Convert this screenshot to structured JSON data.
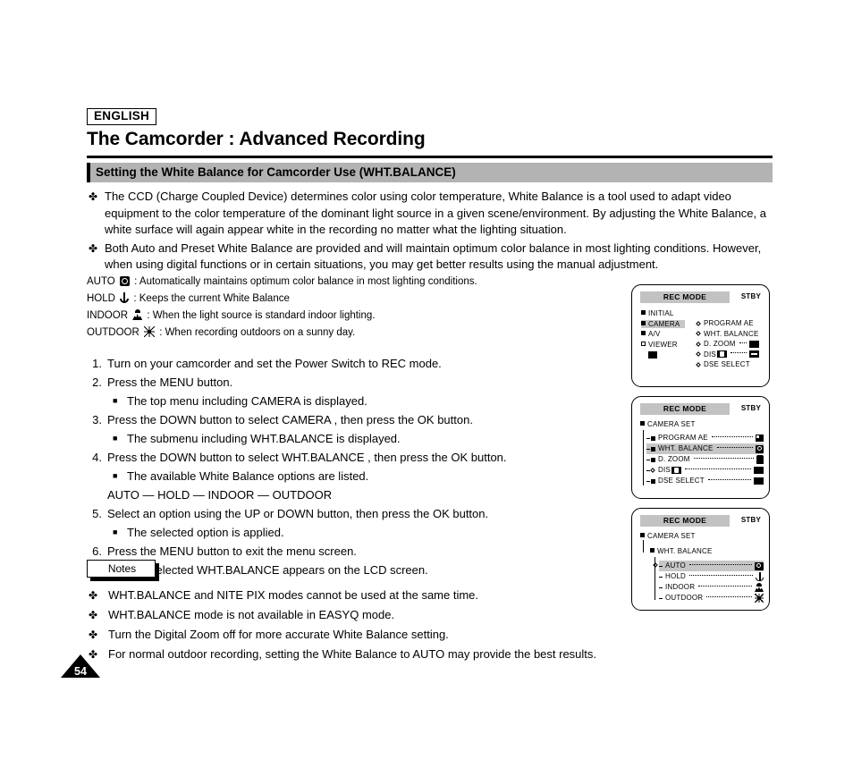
{
  "header": {
    "language_tag": "ENGLISH",
    "title": "The Camcorder : Advanced Recording",
    "section_title": "Setting the White Balance for Camcorder Use (WHT.BALANCE)"
  },
  "intro_bullets": [
    "The CCD (Charge Coupled Device) determines color using color temperature, White Balance is a tool used to adapt video equipment to the color temperature of the dominant light source in a given scene/environment. By adjusting the White Balance, a white surface will again appear white in the recording no matter what the lighting situation.",
    "Both Auto and Preset White Balance are provided and will maintain optimum color balance in most lighting conditions. However, when using digital functions or in certain situations, you may get better results using the manual adjustment."
  ],
  "definitions": [
    {
      "term": "AUTO",
      "icon": "auto-face-icon",
      "text": ": Automatically maintains optimum color balance in most lighting conditions."
    },
    {
      "term": "HOLD",
      "icon": "hold-anchor-icon",
      "text": ": Keeps the current White Balance"
    },
    {
      "term": "INDOOR",
      "icon": "indoor-lamp-icon",
      "text": ": When the light source is standard indoor lighting."
    },
    {
      "term": "OUTDOOR",
      "icon": "outdoor-sun-icon",
      "text": ": When recording outdoors on a sunny day."
    }
  ],
  "steps": [
    {
      "num": "1.",
      "text": "Turn on your camcorder and set the Power Switch to REC mode."
    },
    {
      "num": "2.",
      "text": "Press the MENU button."
    },
    {
      "sub": "The top menu including  CAMERA  is displayed."
    },
    {
      "num": "3.",
      "text": "Press the DOWN button to select  CAMERA , then press the OK button."
    },
    {
      "sub": "The submenu including  WHT.BALANCE  is displayed."
    },
    {
      "num": "4.",
      "text": "Press the DOWN button to select  WHT.BALANCE , then press the OK button."
    },
    {
      "sub": "The available White Balance options are listed."
    },
    {
      "plain": "AUTO — HOLD — INDOOR — OUTDOOR"
    },
    {
      "num": "5.",
      "text": "Select an option using the UP or DOWN button, then press the OK button."
    },
    {
      "sub": "The selected option is applied."
    },
    {
      "num": "6.",
      "text": "Press the MENU button to exit the menu screen."
    },
    {
      "sub": "The selected WHT.BALANCE appears on the LCD screen."
    }
  ],
  "notes": {
    "label": "Notes",
    "items": [
      "WHT.BALANCE and NITE PIX modes cannot be used at the same time.",
      "WHT.BALANCE mode is not available in EASYQ mode.",
      "Turn the Digital Zoom off for more accurate White Balance setting.",
      "For normal outdoor recording, setting the White Balance to AUTO may provide the best results."
    ]
  },
  "page_number": "54",
  "lcd_panels": {
    "panel1": {
      "mode_label": "REC MODE",
      "status": "STBY",
      "left_items": [
        {
          "label": "INITIAL",
          "selected": false
        },
        {
          "label": "CAMERA",
          "selected": true
        },
        {
          "label": "A/V",
          "selected": false
        },
        {
          "label": "VIEWER",
          "selected": false
        }
      ],
      "right_items": [
        {
          "label": "PROGRAM AE",
          "value": ""
        },
        {
          "label": "WHT. BALANCE",
          "value": ""
        },
        {
          "label": "D. ZOOM",
          "value": "off-box"
        },
        {
          "label": "DIS",
          "value": "dis-box"
        },
        {
          "label": "DSE SELECT",
          "value": ""
        }
      ]
    },
    "panel2": {
      "mode_label": "REC MODE",
      "status": "STBY",
      "root": "CAMERA SET",
      "items": [
        {
          "label": "PROGRAM AE",
          "selected": false,
          "value": "ae-icon"
        },
        {
          "label": "WHT. BALANCE",
          "selected": true,
          "value": "wb-icon"
        },
        {
          "label": "D. ZOOM",
          "selected": false,
          "value": "zoom-icon"
        },
        {
          "label": "DIS",
          "selected": false,
          "value": "off-box"
        },
        {
          "label": "DSE SELECT",
          "selected": false,
          "value": "off-box"
        }
      ]
    },
    "panel3": {
      "mode_label": "REC MODE",
      "status": "STBY",
      "root": "CAMERA SET",
      "submenu": "WHT. BALANCE",
      "options": [
        {
          "label": "AUTO",
          "selected": true,
          "icon": "auto-face-icon"
        },
        {
          "label": "HOLD",
          "selected": false,
          "icon": "hold-anchor-icon"
        },
        {
          "label": "INDOOR",
          "selected": false,
          "icon": "indoor-lamp-icon"
        },
        {
          "label": "OUTDOOR",
          "selected": false,
          "icon": "outdoor-sun-icon"
        }
      ]
    }
  },
  "glyphs": {
    "bullet": "✤",
    "square": "■"
  }
}
